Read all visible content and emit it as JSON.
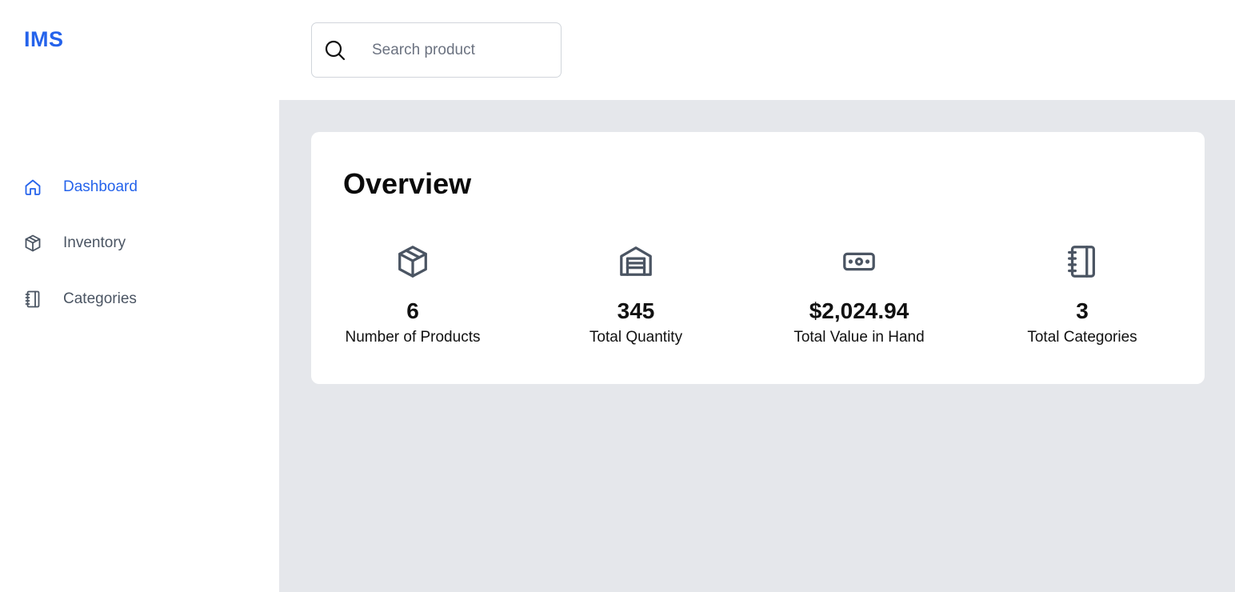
{
  "brand": {
    "name": "IMS",
    "color": "#2563eb"
  },
  "sidebar": {
    "items": [
      {
        "label": "Dashboard",
        "icon": "home-icon",
        "active": true
      },
      {
        "label": "Inventory",
        "icon": "cube-icon",
        "active": false
      },
      {
        "label": "Categories",
        "icon": "notebook-icon",
        "active": false
      }
    ]
  },
  "header": {
    "search": {
      "placeholder": "Search product",
      "value": "",
      "icon": "search-icon"
    }
  },
  "overview": {
    "title": "Overview",
    "stats": [
      {
        "value": "6",
        "label": "Number of Products",
        "icon": "cube-icon"
      },
      {
        "value": "345",
        "label": "Total Quantity",
        "icon": "warehouse-icon"
      },
      {
        "value": "$2,024.94",
        "label": "Total Value in Hand",
        "icon": "banknote-icon"
      },
      {
        "value": "3",
        "label": "Total Categories",
        "icon": "notebook-icon"
      }
    ]
  },
  "colors": {
    "accent": "#2563eb",
    "main_background": "#e5e7eb",
    "icon_gray": "#4b5563"
  }
}
